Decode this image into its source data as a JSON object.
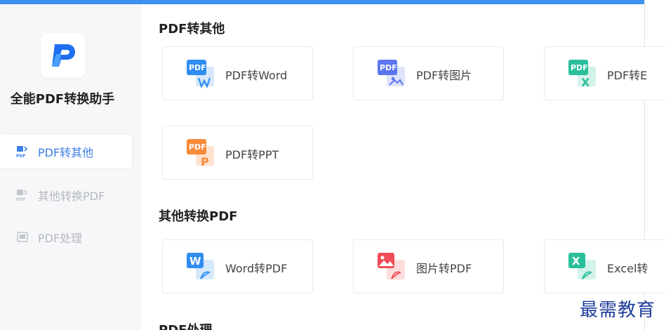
{
  "app": {
    "name": "全能PDF转换助手"
  },
  "colors": {
    "accent": "#3d8ff0",
    "active_text": "#3d7fe6",
    "inactive_text": "#b5b8be"
  },
  "sidebar": {
    "items": [
      {
        "label": "PDF转其他",
        "icon": "pdf-convert-icon",
        "active": true
      },
      {
        "label": "其他转换PDF",
        "icon": "to-pdf-icon",
        "active": false
      },
      {
        "label": "PDF处理",
        "icon": "pdf-tools-icon",
        "active": false
      }
    ]
  },
  "sections": [
    {
      "title": "PDF转其他",
      "cards": [
        {
          "label": "PDF转Word",
          "icon": "pdf-to-word-icon"
        },
        {
          "label": "PDF转图片",
          "icon": "pdf-to-image-icon"
        },
        {
          "label": "PDF转E",
          "icon": "pdf-to-excel-icon"
        },
        {
          "label": "PDF转PPT",
          "icon": "pdf-to-ppt-icon"
        }
      ]
    },
    {
      "title": "其他转换PDF",
      "cards": [
        {
          "label": "Word转PDF",
          "icon": "word-to-pdf-icon"
        },
        {
          "label": "图片转PDF",
          "icon": "image-to-pdf-icon"
        },
        {
          "label": "Excel转",
          "icon": "excel-to-pdf-icon"
        }
      ]
    },
    {
      "title": "PDF处理"
    }
  ],
  "icon_text": {
    "pdf": "PDF",
    "word": "W",
    "excel": "X",
    "ppt": "P"
  },
  "watermark": "最需教育"
}
